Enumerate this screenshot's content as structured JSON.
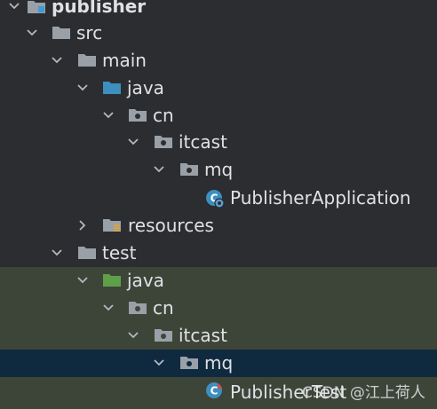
{
  "project_tree": {
    "nodes": [
      {
        "label": "publisher",
        "icon": "module-folder-icon",
        "expanded": true
      },
      {
        "label": "src",
        "icon": "folder-icon",
        "expanded": true
      },
      {
        "label": "main",
        "icon": "folder-icon",
        "expanded": true
      },
      {
        "label": "java",
        "icon": "source-root-folder-icon",
        "expanded": true
      },
      {
        "label": "cn",
        "icon": "package-icon",
        "expanded": true
      },
      {
        "label": "itcast",
        "icon": "package-icon",
        "expanded": true
      },
      {
        "label": "mq",
        "icon": "package-icon",
        "expanded": true
      },
      {
        "label": "PublisherApplication",
        "icon": "spring-boot-class-icon"
      },
      {
        "label": "resources",
        "icon": "resources-folder-icon",
        "expanded": false
      },
      {
        "label": "test",
        "icon": "folder-icon",
        "expanded": true
      },
      {
        "label": "java",
        "icon": "test-root-folder-icon",
        "expanded": true
      },
      {
        "label": "cn",
        "icon": "package-icon",
        "expanded": true
      },
      {
        "label": "itcast",
        "icon": "package-icon",
        "expanded": true
      },
      {
        "label": "mq",
        "icon": "package-icon",
        "expanded": true,
        "selected": true
      },
      {
        "label": "PublisherTest",
        "icon": "test-class-icon"
      }
    ]
  },
  "watermark": "CSDN @江上荷人",
  "colors": {
    "background": "#2b2d30",
    "test_background": "#3d4539",
    "selected_background": "#0f2a3f",
    "source_root": "#3d8fbf",
    "test_root": "#5ea04a"
  }
}
